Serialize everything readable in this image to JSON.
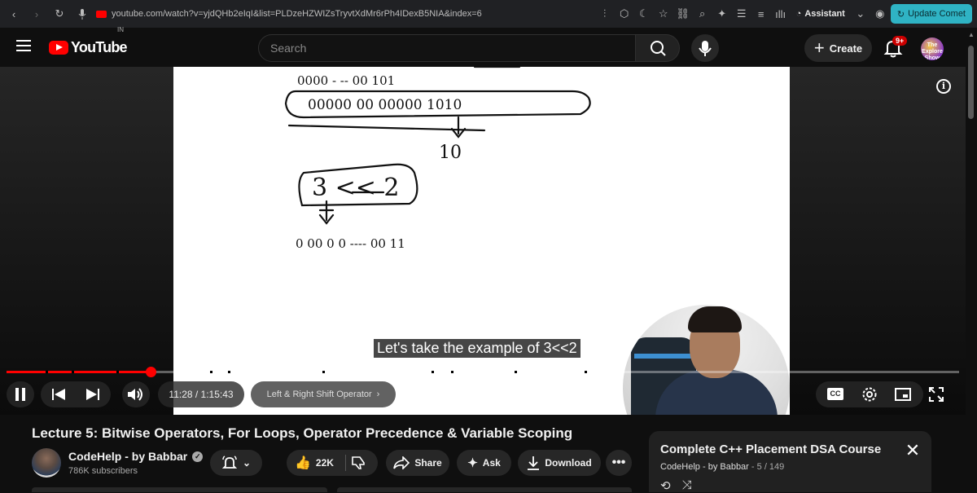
{
  "browser": {
    "url": "youtube.com/watch?v=yjdQHb2eIqI&list=PLDzeHZWIZsTryvtXdMr6rPh4IDexB5NIA&index=6",
    "assistant_label": "Assistant",
    "update_label": "Update Comet"
  },
  "header": {
    "logo_text": "YouTube",
    "country_code": "IN",
    "search_placeholder": "Search",
    "create_label": "Create",
    "notifications_badge": "9+",
    "avatar_text": "The Explore Show"
  },
  "player": {
    "caption": "Let's take the example of 3<<2",
    "current_time": "11:28",
    "duration": "1:15:43",
    "time_display": "11:28 / 1:15:43",
    "chapter": "Left & Right Shift Operator",
    "progress_fraction": 0.151,
    "board_lines": {
      "top_row": "0000 - -- 00  101",
      "boxed_row": "00000 00 00000 1010",
      "result": "10",
      "expression": "3 << 2",
      "bottom_row": "0 00 0 0 ---- 00 11"
    },
    "colors": {
      "progress": "#ff0000"
    }
  },
  "video": {
    "title": "Lecture 5: Bitwise Operators, For Loops, Operator Precedence & Variable Scoping",
    "channel_name": "CodeHelp - by Babbar",
    "subscribers": "786K subscribers",
    "likes": "22K",
    "share_label": "Share",
    "ask_label": "Ask",
    "download_label": "Download"
  },
  "playlist": {
    "title": "Complete C++ Placement DSA Course",
    "channel": "CodeHelp - by Babbar",
    "position": "5 / 149"
  }
}
